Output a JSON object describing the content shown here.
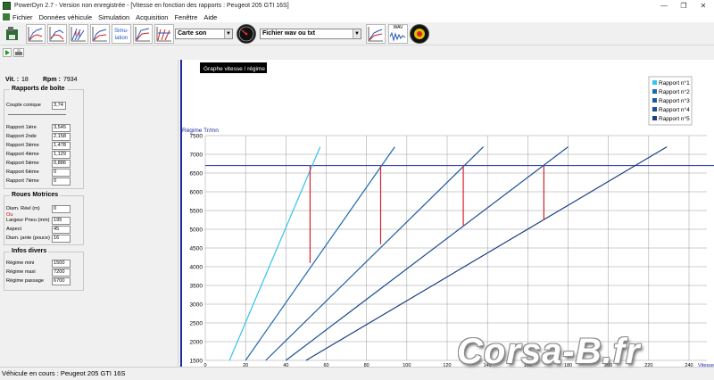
{
  "window": {
    "title": "PowerDyn 2.7 - Version non enregistrée - [Vitesse en fonction des rapports : Peugeot 205 GTI 16S]",
    "controls": [
      "—",
      "❐",
      "✕"
    ]
  },
  "menu": [
    "Fichier",
    "Données véhicule",
    "Simulation",
    "Acquisition",
    "Fenêtre",
    "Aide"
  ],
  "toolbar": {
    "simulation_btn_label": "Simu-lation",
    "sound_combo": "Carte son",
    "file_combo": "Fichier wav ou txt",
    "wav_label": "WAV",
    "icons": [
      "save-icon",
      "graph-icon",
      "gauge-icon",
      "sound-icon"
    ]
  },
  "status": {
    "vit_label": "Vit. :",
    "vit_value": "18",
    "rpm_label": "Rpm :",
    "rpm_value": "7934"
  },
  "rapports": {
    "title": "Rapports de boîte",
    "couple_label": "Couple conique",
    "couple_value": "3,74",
    "items": [
      {
        "label": "Rapport 1ière",
        "value": "3,545"
      },
      {
        "label": "Rapport 2nde",
        "value": "2,158"
      },
      {
        "label": "Rapport 3ième",
        "value": "1,478"
      },
      {
        "label": "Rapport 4ième",
        "value": "1,129"
      },
      {
        "label": "Rapport 5ième",
        "value": "0,886"
      },
      {
        "label": "Rapport 6ième",
        "value": "0"
      },
      {
        "label": "Rapport 7ième",
        "value": "0"
      }
    ]
  },
  "roues": {
    "title": "Roues Motrices",
    "diam_label": "Diam. Réel (m)",
    "diam_value": "0",
    "ou_label": "Ou",
    "largeur_label": "Largeur Pneu (mm)",
    "largeur_value": "195",
    "aspect_label": "Aspect",
    "aspect_value": "45",
    "jante_label": "Diam. jante (pouce)",
    "jante_value": "16"
  },
  "infos": {
    "title": "Infos divers",
    "regime_mini_label": "Régime mini",
    "regime_mini_value": "1500",
    "regime_maxi_label": "Régime maxi",
    "regime_maxi_value": "7200",
    "regime_passage_label": "Régime passage",
    "regime_passage_value": "6700"
  },
  "statusbar": "Véhicule en cours : Peugeot 205 GTI 16S",
  "watermark": "Corsa-B.fr",
  "chart_data": {
    "type": "line",
    "title": "Graphe vitesse / régime",
    "ylabel": "Régime Tr/mn",
    "xlabel": "Vitesse",
    "xlim": [
      0,
      240
    ],
    "ylim": [
      1500,
      7500
    ],
    "x_ticks": [
      "0",
      "20",
      "40",
      "60",
      "80",
      "100",
      "120",
      "140",
      "160",
      "180",
      "200",
      "220",
      "240"
    ],
    "y_ticks": [
      "1500",
      "2000",
      "2500",
      "3000",
      "3500",
      "4000",
      "4500",
      "5000",
      "5500",
      "6000",
      "6500",
      "7000",
      "7500"
    ],
    "grid": true,
    "legend_position": "top-right",
    "shift_rpm": 6700,
    "series": [
      {
        "name": "Rapport n°1",
        "color": "#33c3ee",
        "points": [
          [
            12,
            1500
          ],
          [
            57,
            7200
          ]
        ]
      },
      {
        "name": "Rapport n°2",
        "color": "#1f69b0",
        "points": [
          [
            20,
            1500
          ],
          [
            94,
            7200
          ]
        ]
      },
      {
        "name": "Rapport n°3",
        "color": "#1f5aa0",
        "points": [
          [
            30,
            1500
          ],
          [
            138,
            7200
          ]
        ]
      },
      {
        "name": "Rapport n°4",
        "color": "#1c4f92",
        "points": [
          [
            40,
            1500
          ],
          [
            180,
            7200
          ]
        ]
      },
      {
        "name": "Rapport n°5",
        "color": "#183f82",
        "points": [
          [
            50,
            1500
          ],
          [
            229,
            7200
          ]
        ]
      }
    ],
    "shift_drops": [
      {
        "x": 52,
        "from": 6700,
        "to": 4100
      },
      {
        "x": 87,
        "from": 6700,
        "to": 4600
      },
      {
        "x": 128,
        "from": 6700,
        "to": 5100
      },
      {
        "x": 168,
        "from": 6700,
        "to": 5250
      }
    ]
  }
}
